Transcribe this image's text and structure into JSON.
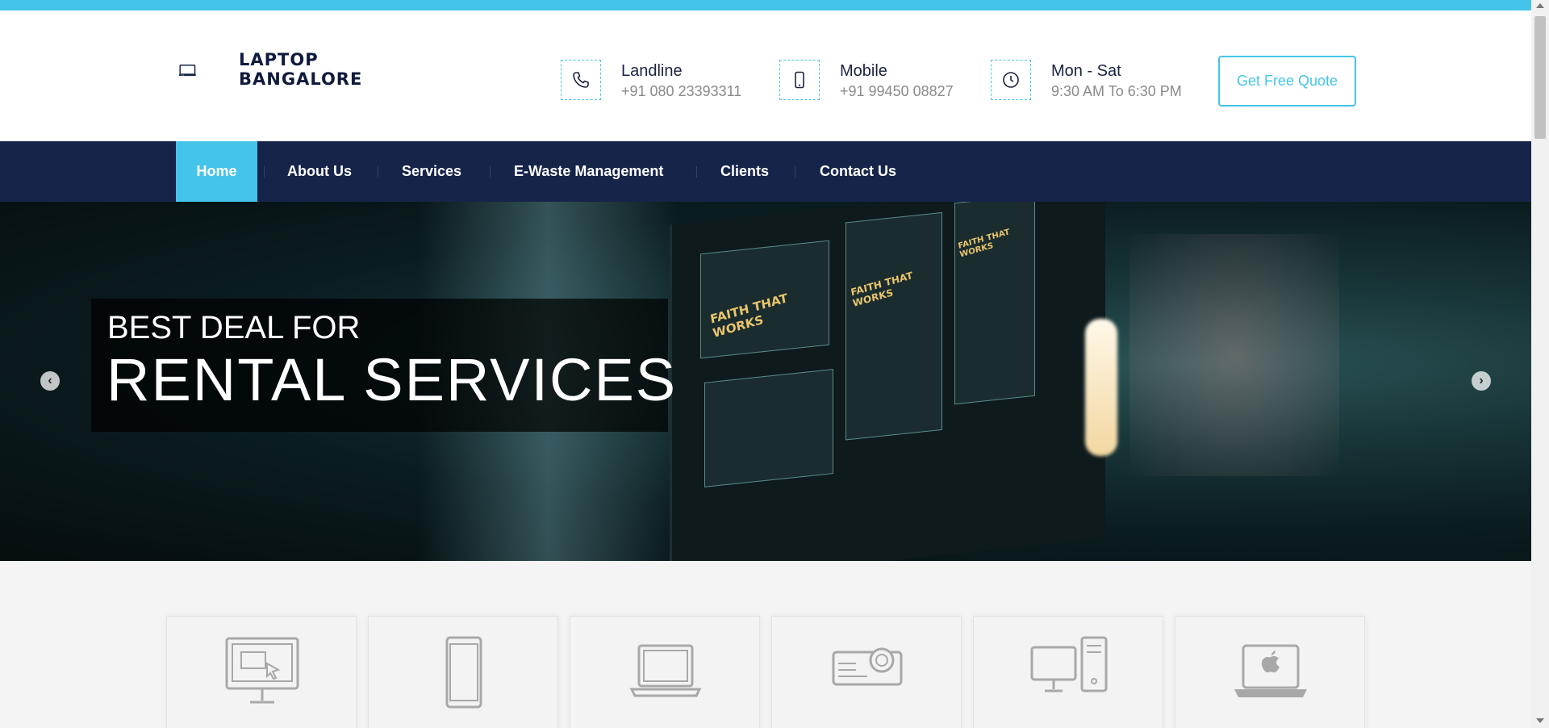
{
  "brand": {
    "logo_line1": "LAPTOP",
    "logo_line2": "BANGALORE",
    "accent_color": "#45c4ea",
    "navy_color": "#16244a"
  },
  "contact": [
    {
      "icon": "phone-icon",
      "title": "Landline",
      "value": "+91 080 23393311"
    },
    {
      "icon": "mobile-icon",
      "title": "Mobile",
      "value": "+91 99450 08827"
    },
    {
      "icon": "clock-icon",
      "title": "Mon - Sat",
      "value": "9:30 AM To 6:30 PM"
    }
  ],
  "quote_button": "Get Free Quote",
  "nav": {
    "items": [
      "Home",
      "About Us",
      "Services",
      "E-Waste Management",
      "Clients",
      "Contact Us"
    ],
    "active": "Home"
  },
  "hero": {
    "line1": "BEST DEAL FOR",
    "line2": "RENTAL SERVICES",
    "panel_text_1": "FAITH THAT WORKS",
    "panel_text_2": "FAITH THAT WORKS",
    "panel_text_3": "FAITH THAT WORKS",
    "prev_arrow": "‹",
    "next_arrow": "›"
  },
  "cards": [
    {
      "icon": "desktop-monitor-icon"
    },
    {
      "icon": "tablet-icon"
    },
    {
      "icon": "laptop-icon"
    },
    {
      "icon": "projector-icon"
    },
    {
      "icon": "desktop-tower-icon"
    },
    {
      "icon": "macbook-icon"
    }
  ]
}
